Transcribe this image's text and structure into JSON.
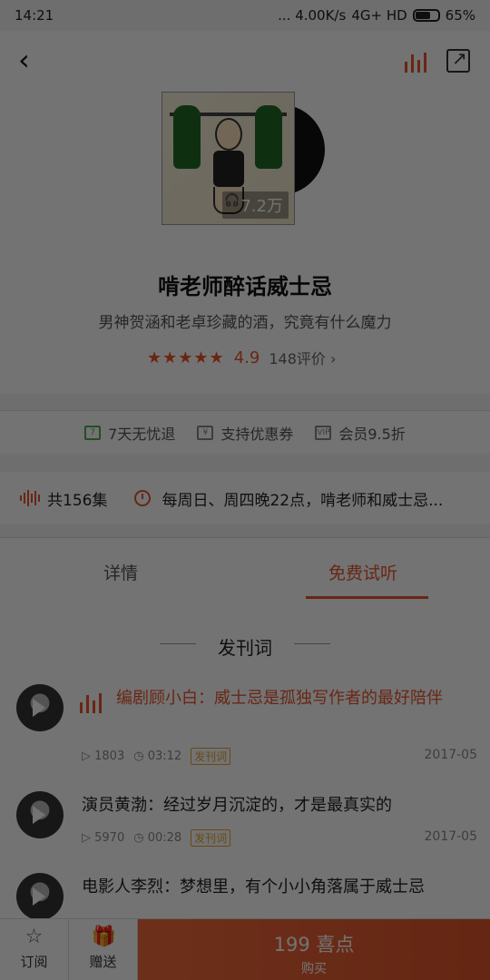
{
  "status_bar": {
    "time": "14:21",
    "network_speed": "... 4.00K/s",
    "signal": "4G+ HD",
    "battery": "65%"
  },
  "header": {
    "plays": "7.2万",
    "title": "啃老师醉话威士忌",
    "subtitle": "男神贺涵和老卓珍藏的酒，究竟有什么魔力",
    "stars": "★★★★★",
    "score": "4.9",
    "reviews": "148评价 ›"
  },
  "perks": [
    {
      "label": "7天无忧退",
      "icon": "refund-icon"
    },
    {
      "label": "支持优惠券",
      "icon": "coupon-icon"
    },
    {
      "label": "会员9.5折",
      "icon": "vip-icon"
    }
  ],
  "episodes": {
    "count": "共156集",
    "schedule": "每周日、周四晚22点，啃老师和威士忌..."
  },
  "tabs": [
    {
      "label": "详情"
    },
    {
      "label": "免费试听"
    }
  ],
  "section": {
    "title": "发刊词"
  },
  "items": [
    {
      "title": "编剧顾小白：威士忌是孤独写作者的最好陪伴",
      "plays": "▷ 1803",
      "duration": "◷ 03:12",
      "badge": "发刊词",
      "date": "2017-05"
    },
    {
      "title": "演员黄渤：经过岁月沉淀的，才是最真实的",
      "plays": "▷ 5970",
      "duration": "◷ 00:28",
      "badge": "发刊词",
      "date": "2017-05"
    },
    {
      "title": "电影人李烈：梦想里，有个小小角落属于威士忌"
    }
  ],
  "bottom": {
    "subscribe": "订阅",
    "gift": "赠送",
    "price": "199 喜点",
    "buy": "购买"
  },
  "colors": {
    "accent": "#e8562f"
  }
}
